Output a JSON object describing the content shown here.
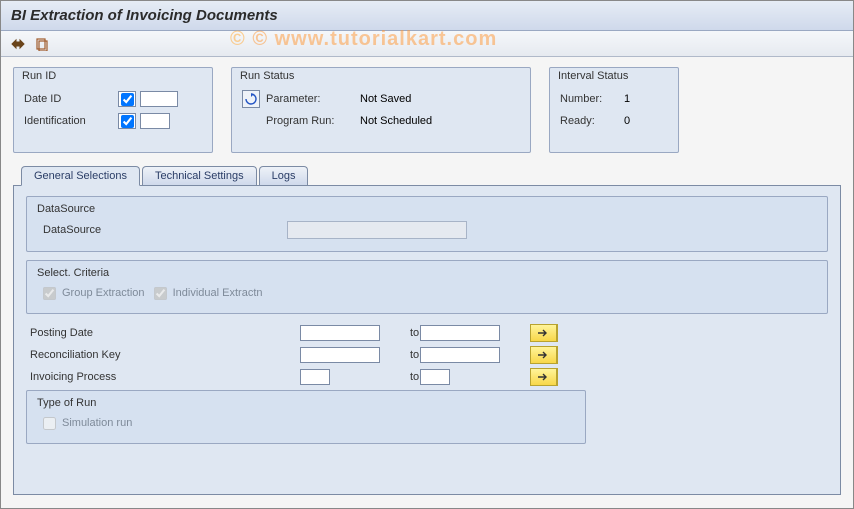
{
  "title": "BI Extraction of Invoicing Documents",
  "watermark": "© www.tutorialkart.com",
  "run_id": {
    "title": "Run ID",
    "date_id_label": "Date ID",
    "identification_label": "Identification",
    "date_id_value": "",
    "identification_value": ""
  },
  "run_status": {
    "title": "Run Status",
    "parameter_label": "Parameter:",
    "parameter_value": "Not Saved",
    "program_run_label": "Program Run:",
    "program_run_value": "Not Scheduled"
  },
  "interval_status": {
    "title": "Interval Status",
    "number_label": "Number:",
    "number_value": "1",
    "ready_label": "Ready:",
    "ready_value": "0"
  },
  "tabs": {
    "general": "General Selections",
    "technical": "Technical Settings",
    "logs": "Logs"
  },
  "datasource": {
    "group_title": "DataSource",
    "label": "DataSource",
    "value": ""
  },
  "select_criteria": {
    "title": "Select. Criteria",
    "group_extraction_label": "Group Extraction",
    "individual_extraction_label": "Individual Extractn"
  },
  "range_fields": {
    "posting_date_label": "Posting Date",
    "reconciliation_key_label": "Reconciliation Key",
    "invoicing_process_label": "Invoicing Process",
    "to_label": "to"
  },
  "type_of_run": {
    "title": "Type of Run",
    "simulation_label": "Simulation run"
  }
}
